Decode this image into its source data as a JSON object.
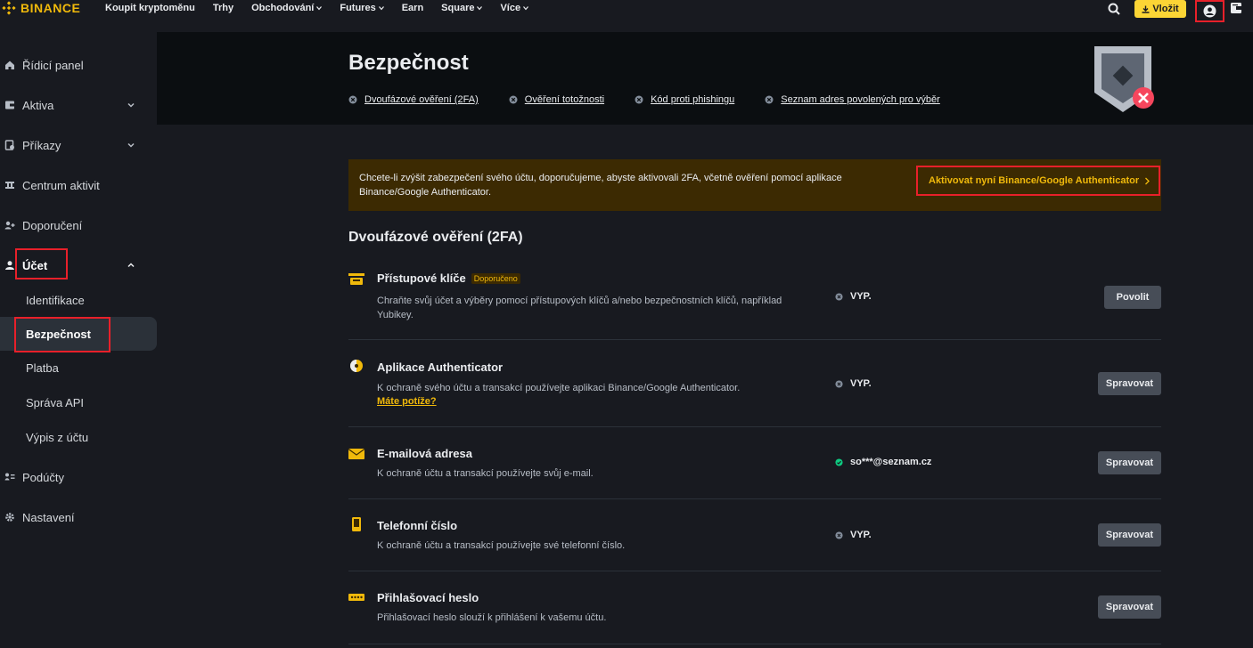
{
  "topnav": {
    "logo": "BINANCE",
    "items": [
      {
        "label": "Koupit kryptoměnu",
        "has_chevron": false
      },
      {
        "label": "Trhy",
        "has_chevron": false
      },
      {
        "label": "Obchodování",
        "has_chevron": true
      },
      {
        "label": "Futures",
        "has_chevron": true
      },
      {
        "label": "Earn",
        "has_chevron": false
      },
      {
        "label": "Square",
        "has_chevron": true
      },
      {
        "label": "Více",
        "has_chevron": true
      }
    ],
    "deposit_label": "Vložit",
    "icons": [
      "search-icon",
      "download-icon",
      "user-icon",
      "wallet-icon"
    ]
  },
  "sidebar": {
    "items": [
      {
        "label": "Řídicí panel",
        "icon": "home-icon"
      },
      {
        "label": "Aktiva",
        "icon": "wallet-icon",
        "chevron": "down"
      },
      {
        "label": "Příkazy",
        "icon": "orders-icon",
        "chevron": "down"
      },
      {
        "label": "Centrum aktivit",
        "icon": "activity-icon"
      },
      {
        "label": "Doporučení",
        "icon": "referral-icon"
      },
      {
        "label": "Účet",
        "icon": "user-icon",
        "chevron": "up"
      }
    ],
    "sub_items": [
      {
        "label": "Identifikace"
      },
      {
        "label": "Bezpečnost",
        "active": true
      },
      {
        "label": "Platba"
      },
      {
        "label": "Správa API"
      },
      {
        "label": "Výpis z účtu"
      }
    ],
    "bottom_items": [
      {
        "label": "Podúčty",
        "icon": "subaccount-icon"
      },
      {
        "label": "Nastavení",
        "icon": "gear-icon"
      }
    ]
  },
  "header": {
    "title": "Bezpečnost",
    "quick_links": [
      "Dvoufázové ověření (2FA)",
      "Ověření totožnosti",
      "Kód proti phishingu",
      "Seznam adres povolených pro výběr"
    ]
  },
  "banner": {
    "text": "Chcete-li zvýšit zabezpečení svého účtu, doporučujeme, abyste aktivovali 2FA, včetně ověření pomocí aplikace Binance/Google Authenticator.",
    "link": "Aktivovat nyní Binance/Google Authenticator",
    "bg_color": "#3c2a02",
    "accent_color": "#f0b90b"
  },
  "section_title": "Dvoufázové ověření (2FA)",
  "rows": [
    {
      "title": "Přístupové klíče",
      "badge": "Doporučeno",
      "desc": "Chraňte svůj účet a výběry pomocí přístupových klíčů a/nebo bezpečnostních klíčů, například Yubikey.",
      "status": "VYP.",
      "status_on": false,
      "button": "Povolit",
      "icon": "passkey-icon"
    },
    {
      "title": "Aplikace Authenticator",
      "desc": "K ochraně svého účtu a transakcí používejte aplikaci Binance/Google Authenticator.",
      "link": "Máte potíže?",
      "status": "VYP.",
      "status_on": false,
      "button": "Spravovat",
      "icon": "authenticator-icon"
    },
    {
      "title": "E-mailová adresa",
      "desc": "K ochraně účtu a transakcí používejte svůj e-mail.",
      "status": "so***@seznam.cz",
      "status_on": true,
      "button": "Spravovat",
      "icon": "email-icon"
    },
    {
      "title": "Telefonní číslo",
      "desc": "K ochraně účtu a transakcí používejte své telefonní číslo.",
      "status": "VYP.",
      "status_on": false,
      "button": "Spravovat",
      "icon": "phone-icon"
    },
    {
      "title": "Přihlašovací heslo",
      "desc": "Přihlašovací heslo slouží k přihlášení k vašemu účtu.",
      "button": "Spravovat",
      "icon": "password-icon"
    }
  ]
}
